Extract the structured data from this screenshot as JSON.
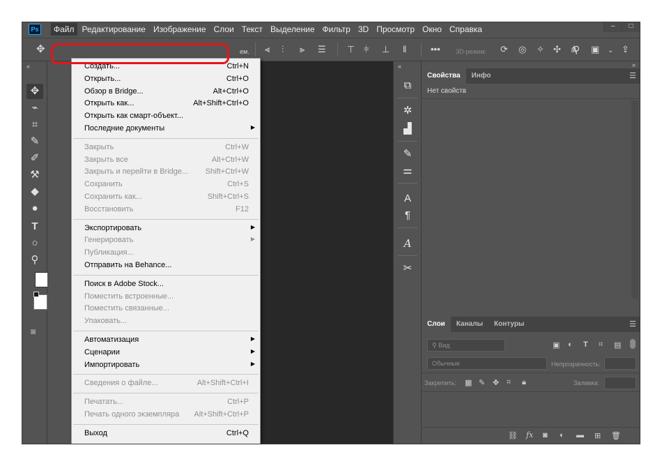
{
  "app": {
    "logo": "Ps"
  },
  "menubar": {
    "items": [
      "Файл",
      "Редактирование",
      "Изображение",
      "Слои",
      "Текст",
      "Выделение",
      "Фильтр",
      "3D",
      "Просмотр",
      "Окно",
      "Справка"
    ],
    "active": "Файл"
  },
  "window_controls": {
    "minimize": "–",
    "restore": "□"
  },
  "options_bar": {
    "truncated_label": "ем.",
    "mode_3d": "3D-режим:"
  },
  "file_menu": {
    "groups": [
      [
        {
          "label": "Создать...",
          "shortcut": "Ctrl+N",
          "enabled": true
        },
        {
          "label": "Открыть...",
          "shortcut": "Ctrl+O",
          "enabled": true,
          "highlighted": true
        },
        {
          "label": "Обзор в Bridge...",
          "shortcut": "Alt+Ctrl+O",
          "enabled": true
        },
        {
          "label": "Открыть как...",
          "shortcut": "Alt+Shift+Ctrl+O",
          "enabled": true
        },
        {
          "label": "Открыть как смарт-объект...",
          "shortcut": "",
          "enabled": true
        },
        {
          "label": "Последние документы",
          "shortcut": "",
          "enabled": true,
          "submenu": true
        }
      ],
      [
        {
          "label": "Закрыть",
          "shortcut": "Ctrl+W",
          "enabled": false
        },
        {
          "label": "Закрыть все",
          "shortcut": "Alt+Ctrl+W",
          "enabled": false
        },
        {
          "label": "Закрыть и перейти в Bridge...",
          "shortcut": "Shift+Ctrl+W",
          "enabled": false
        },
        {
          "label": "Сохранить",
          "shortcut": "Ctrl+S",
          "enabled": false
        },
        {
          "label": "Сохранить как...",
          "shortcut": "Shift+Ctrl+S",
          "enabled": false
        },
        {
          "label": "Восстановить",
          "shortcut": "F12",
          "enabled": false
        }
      ],
      [
        {
          "label": "Экспортировать",
          "shortcut": "",
          "enabled": true,
          "submenu": true
        },
        {
          "label": "Генерировать",
          "shortcut": "",
          "enabled": false,
          "submenu": true
        },
        {
          "label": "Публикация...",
          "shortcut": "",
          "enabled": false
        },
        {
          "label": "Отправить на Behance...",
          "shortcut": "",
          "enabled": true
        }
      ],
      [
        {
          "label": "Поиск в Adobe Stock...",
          "shortcut": "",
          "enabled": true
        },
        {
          "label": "Поместить встроенные...",
          "shortcut": "",
          "enabled": false
        },
        {
          "label": "Поместить связанные...",
          "shortcut": "",
          "enabled": false
        },
        {
          "label": "Упаковать...",
          "shortcut": "",
          "enabled": false
        }
      ],
      [
        {
          "label": "Автоматизация",
          "shortcut": "",
          "enabled": true,
          "submenu": true
        },
        {
          "label": "Сценарии",
          "shortcut": "",
          "enabled": true,
          "submenu": true
        },
        {
          "label": "Импортировать",
          "shortcut": "",
          "enabled": true,
          "submenu": true
        }
      ],
      [
        {
          "label": "Сведения о файле...",
          "shortcut": "Alt+Shift+Ctrl+I",
          "enabled": false
        }
      ],
      [
        {
          "label": "Печатать...",
          "shortcut": "Ctrl+P",
          "enabled": false
        },
        {
          "label": "Печать одного экземпляра",
          "shortcut": "Alt+Shift+Ctrl+P",
          "enabled": false
        }
      ],
      [
        {
          "label": "Выход",
          "shortcut": "Ctrl+Q",
          "enabled": true
        }
      ]
    ]
  },
  "properties_panel": {
    "tabs": [
      "Свойства",
      "Инфо"
    ],
    "active_tab": "Свойства",
    "empty_text": "Нет свойств"
  },
  "layers_panel": {
    "tabs": [
      "Слои",
      "Каналы",
      "Контуры"
    ],
    "active_tab": "Слои",
    "filter_placeholder": "Вид",
    "blend_mode": "Обычные",
    "opacity_label": "Непрозрачность:",
    "lock_label": "Закрепить:",
    "fill_label": "Заливка:"
  },
  "colors": {
    "highlight_ring": "#e8141b",
    "ps_blue": "#31a8ff"
  }
}
